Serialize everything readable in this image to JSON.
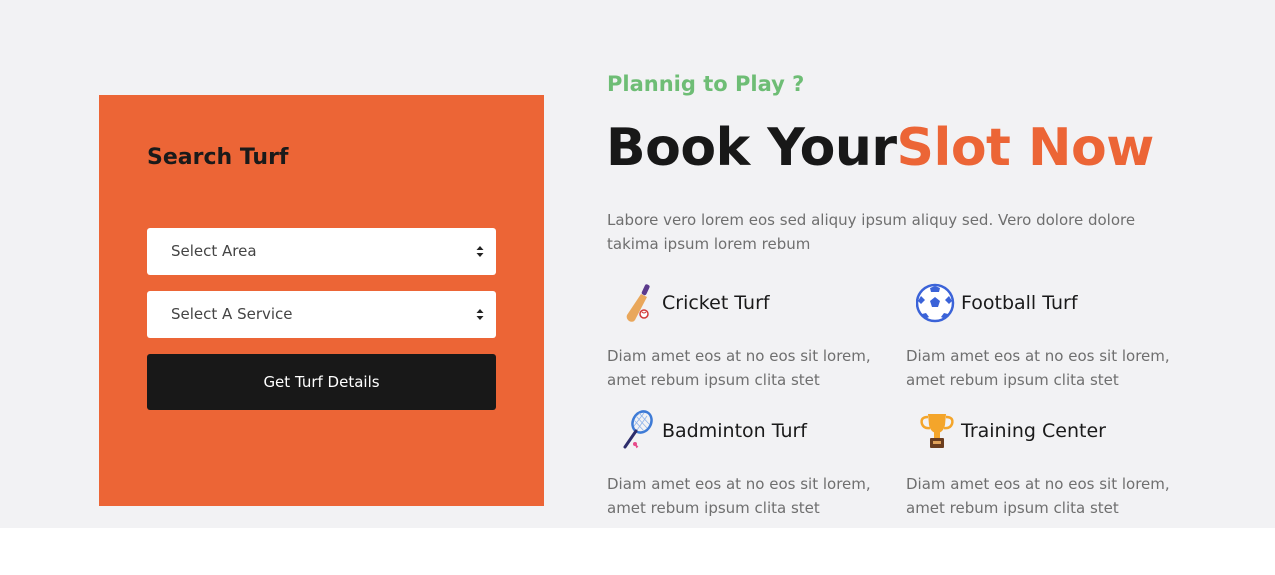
{
  "search": {
    "title": "Search Turf",
    "area_select": {
      "value": "Select Area"
    },
    "service_select": {
      "value": "Select A Service"
    },
    "submit_label": "Get Turf Details"
  },
  "hero": {
    "tagline": "Plannig to Play ?",
    "headline_part1": "Book Your",
    "headline_part2": "Slot Now",
    "intro": "Labore vero lorem eos sed aliquy ipsum aliquy sed. Vero dolore dolore takima ipsum lorem rebum"
  },
  "features": [
    {
      "icon": "cricket-bat-icon",
      "name": "Cricket Turf",
      "description": "Diam amet eos at no eos sit lorem, amet rebum ipsum clita stet"
    },
    {
      "icon": "football-icon",
      "name": "Football Turf",
      "description": "Diam amet eos at no eos sit lorem, amet rebum ipsum clita stet"
    },
    {
      "icon": "badminton-racket-icon",
      "name": "Badminton Turf",
      "description": "Diam amet eos at no eos sit lorem, amet rebum ipsum clita stet"
    },
    {
      "icon": "trophy-icon",
      "name": "Training Center",
      "description": "Diam amet eos at no eos sit lorem, amet rebum ipsum clita stet"
    }
  ],
  "colors": {
    "accent": "#ec6536",
    "tagline_green": "#6ebd75",
    "dark": "#181818",
    "section_bg": "#f2f2f4"
  }
}
